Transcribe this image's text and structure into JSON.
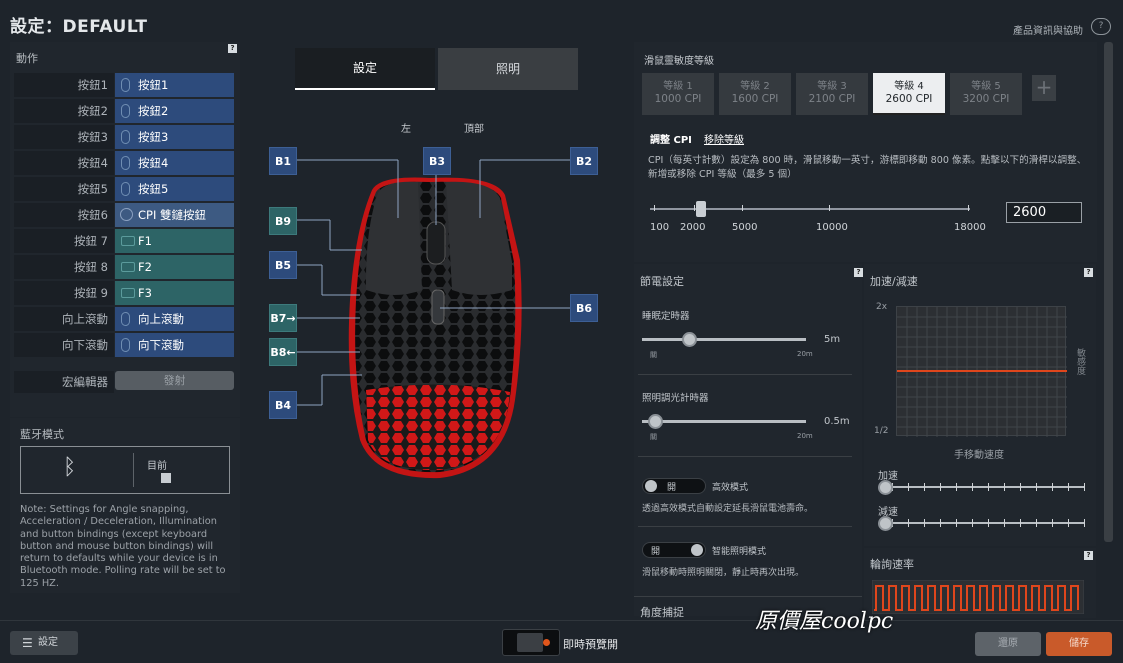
{
  "header": {
    "title": "設定：DEFAULT",
    "product_info": "產品資訊與協助"
  },
  "actions": {
    "heading": "動作",
    "rows": [
      {
        "label": "按鈕1",
        "value": "按鈕1"
      },
      {
        "label": "按鈕2",
        "value": "按鈕2"
      },
      {
        "label": "按鈕3",
        "value": "按鈕3"
      },
      {
        "label": "按鈕4",
        "value": "按鈕4"
      },
      {
        "label": "按鈕5",
        "value": "按鈕5"
      },
      {
        "label": "按鈕6",
        "value": "CPI 雙鏈按鈕"
      },
      {
        "label": "按鈕 7",
        "value": "F1"
      },
      {
        "label": "按鈕 8",
        "value": "F2"
      },
      {
        "label": "按鈕 9",
        "value": "F3"
      },
      {
        "label": "向上滾動",
        "value": "向上滾動"
      },
      {
        "label": "向下滾動",
        "value": "向下滾動"
      }
    ],
    "macro_label": "宏編輯器",
    "macro_button": "發射"
  },
  "bluetooth": {
    "heading": "藍牙模式",
    "current_label": "目前",
    "note": "Note: Settings for Angle snapping, Acceleration / Deceleration, Illumination and button bindings (except keyboard button and mouse button bindings) will return to defaults while your device is in Bluetooth mode. Polling rate will be set to 125 HZ."
  },
  "center": {
    "tab_settings": "設定",
    "tab_lighting": "照明",
    "view_left": "左",
    "view_top": "頂部",
    "buttons": [
      "B1",
      "B3",
      "B2",
      "B9",
      "B5",
      "B7→",
      "B6",
      "B8←",
      "B4"
    ]
  },
  "cpi": {
    "heading": "滑鼠靈敏度等級",
    "levels": [
      {
        "name": "等級 1",
        "value": "1000 CPI"
      },
      {
        "name": "等級 2",
        "value": "1600 CPI"
      },
      {
        "name": "等級 3",
        "value": "2100 CPI"
      },
      {
        "name": "等級 4",
        "value": "2600 CPI"
      },
      {
        "name": "等級 5",
        "value": "3200 CPI"
      }
    ],
    "active_level": 4,
    "add_label": "+",
    "adjust_tab": "調整 CPI",
    "remove_tab": "移除等級",
    "description": "CPI（每英寸計數）設定為 800 時，滑鼠移動一英寸，游標即移動 800 像素。點擊以下的滑桿以調整、新增或移除 CPI 等級（最多 5 個）",
    "ticks": [
      "100",
      "2000",
      "5000",
      "10000",
      "18000"
    ],
    "value": "2600",
    "slider_min": 100,
    "slider_max": 18000
  },
  "power": {
    "heading": "節電設定",
    "sleep_label": "睡眠定時器",
    "sleep_value": "5m",
    "sleep_min": "關",
    "sleep_max": "20m",
    "dim_label": "照明調光計時器",
    "dim_value": "0.5m",
    "dim_min": "關",
    "dim_max": "20m",
    "eff_toggle": "開",
    "eff_label": "高效模式",
    "eff_desc": "透過高效模式自動設定延長滑鼠電池壽命。",
    "smart_toggle": "開",
    "smart_label": "智能照明模式",
    "smart_desc": "滑鼠移動時照明關閉，靜止時再次出現。",
    "angle_heading": "角度捕捉"
  },
  "accel": {
    "heading": "加速/減速",
    "y_top": "2x",
    "y_bottom": "1/2",
    "x_label": "手移動速度",
    "side_label": "敏感度",
    "acc_label": "加速",
    "dec_label": "減速"
  },
  "polling": {
    "heading": "輪詢速率"
  },
  "footer": {
    "settings": "設定",
    "preview": "即時預覽開",
    "reset": "還原",
    "save": "儲存",
    "watermark": "原價屋coolpc"
  }
}
